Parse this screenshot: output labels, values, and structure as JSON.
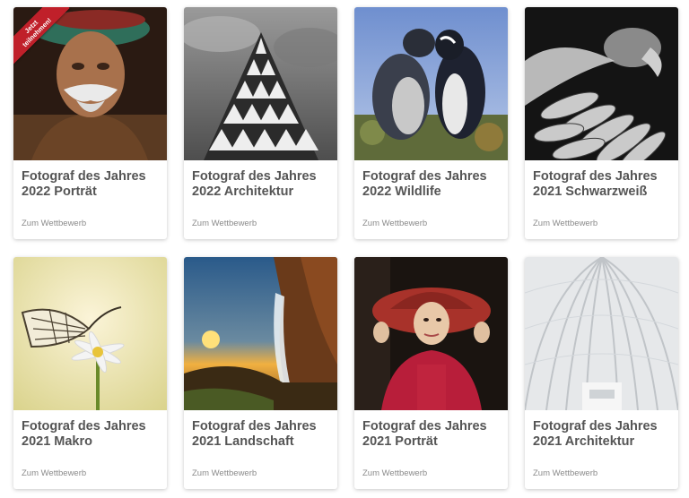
{
  "ribbon": {
    "line1": "Jetzt",
    "line2": "teilnehmen!"
  },
  "cards": [
    {
      "title_line1": "Fotograf des Jahres",
      "title_line2": "2022 Porträt",
      "link": "Zum Wettbewerb",
      "image": "portrait-man-turban"
    },
    {
      "title_line1": "Fotograf des Jahres",
      "title_line2": "2022 Architektur",
      "link": "Zum Wettbewerb",
      "image": "architecture-triangles-bw"
    },
    {
      "title_line1": "Fotograf des Jahres",
      "title_line2": "2022 Wildlife",
      "link": "Zum Wettbewerb",
      "image": "penguins"
    },
    {
      "title_line1": "Fotograf des Jahres",
      "title_line2": "2021 Schwarzweiß",
      "link": "Zum Wettbewerb",
      "image": "vulture-bw"
    },
    {
      "title_line1": "Fotograf des Jahres",
      "title_line2": "2021 Makro",
      "link": "Zum Wettbewerb",
      "image": "butterfly-flower"
    },
    {
      "title_line1": "Fotograf des Jahres",
      "title_line2": "2021 Landschaft",
      "link": "Zum Wettbewerb",
      "image": "waterfall-sunset"
    },
    {
      "title_line1": "Fotograf des Jahres",
      "title_line2": "2021 Porträt",
      "link": "Zum Wettbewerb",
      "image": "woman-red-hat"
    },
    {
      "title_line1": "Fotograf des Jahres",
      "title_line2": "2021 Architektur",
      "link": "Zum Wettbewerb",
      "image": "white-arches-architecture"
    }
  ]
}
